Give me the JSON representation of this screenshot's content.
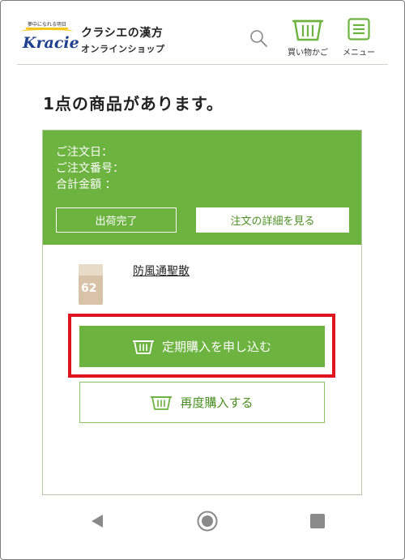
{
  "header": {
    "logo_tagline": "夢中になれる明日",
    "logo_text": "Kracie",
    "brand_name": "クラシエの漢方",
    "brand_sub": "オンラインショップ",
    "search_icon": "search-icon",
    "cart_label": "買い物かご",
    "menu_label": "メニュー",
    "accent_color": "#6cb33f"
  },
  "main": {
    "title": "1点の商品があります。",
    "order": {
      "date_label": "ご注文日：",
      "number_label": "ご注文番号：",
      "total_label": "合計金額 ：",
      "status_button": "出荷完了",
      "detail_button": "注文の詳細を見る",
      "product": {
        "name": "防風通聖散",
        "package_number": "62"
      },
      "subscribe_button": "定期購入を申し込む",
      "reorder_button": "再度購入する",
      "highlight_color": "#e0141e"
    }
  },
  "navbar": {
    "back_icon": "back-triangle-icon",
    "home_icon": "home-circle-icon",
    "recent_icon": "recent-square-icon"
  }
}
